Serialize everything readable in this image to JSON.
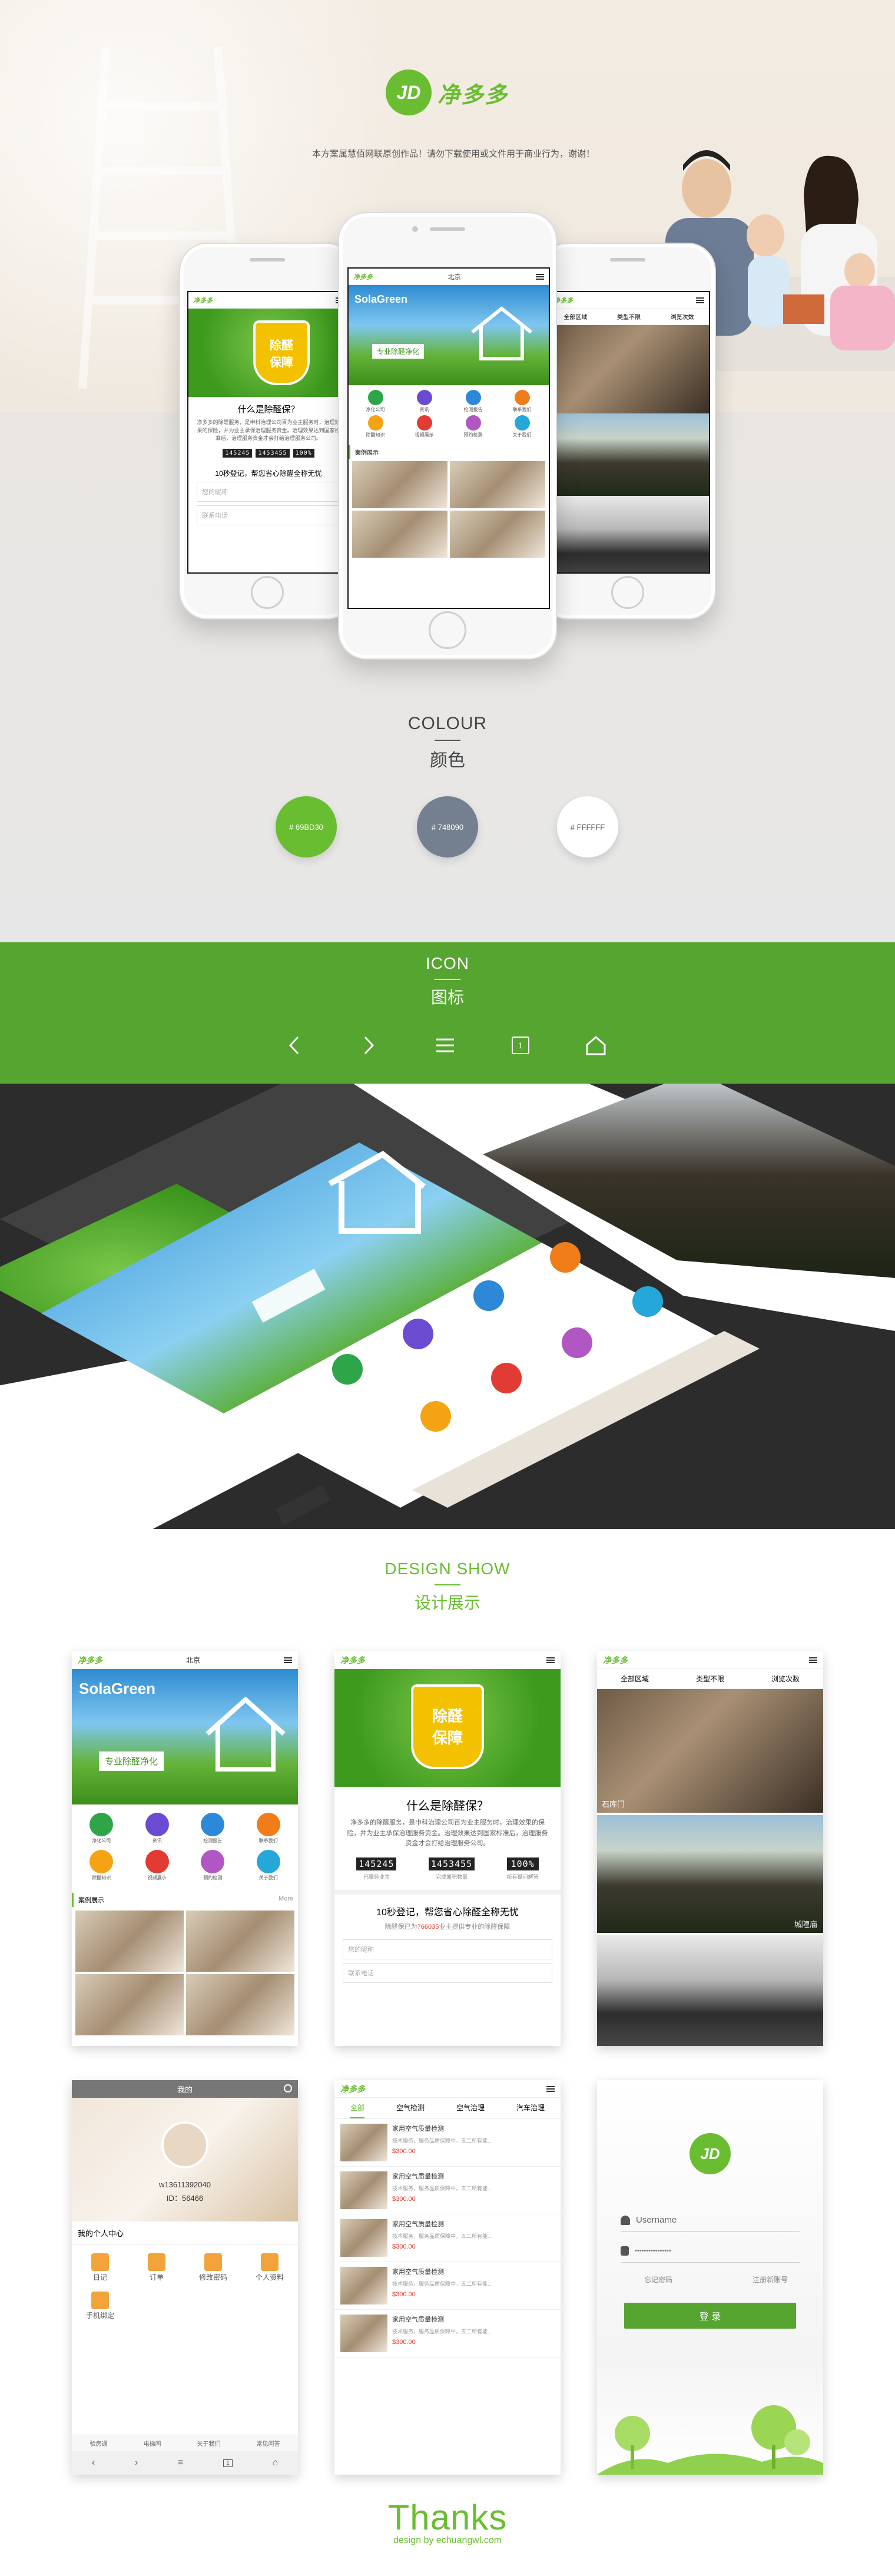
{
  "brand": {
    "name": "净多多",
    "logo_mark": "JD"
  },
  "intro": "本方案属慧佰网联原创作品！请勿下载使用或文件用于商业行为，谢谢！",
  "colour": {
    "title_en": "COLOUR",
    "title_cn": "颜色",
    "swatches": [
      {
        "label": "# 69BD30",
        "color": "#69BD30"
      },
      {
        "label": "# 748090",
        "color": "#748090"
      },
      {
        "label": "# FFFFFF",
        "color": "#FFFFFF"
      }
    ]
  },
  "icon_section": {
    "title_en": "ICON",
    "title_cn": "图标",
    "page_num": "1"
  },
  "design_show": {
    "title_en": "DESIGN SHOW",
    "title_cn": "设计展示"
  },
  "home_screen": {
    "city": "北京",
    "banner_logo": "SolaGreen",
    "banner_text": "专业除醛净化",
    "menu": [
      "净化公司",
      "资讯",
      "检测报告",
      "联系我们",
      "除醛知识",
      "视频展示",
      "预约检测",
      "关于我们"
    ],
    "section_title": "案例展示",
    "more": "More"
  },
  "about_screen": {
    "badge_line1": "除醛",
    "badge_line2": "保障",
    "question": "什么是除醛保？",
    "body": "净多多的除醛服务，是申科治理公司百为业主服务时，治理效果的保险，并为业主承保治理服务资金。治理效果达到国家标准后，治理服务资金才会打给治理服务公司。",
    "stats": [
      {
        "value": "145245",
        "label": "已服务业主"
      },
      {
        "value": "1453455",
        "label": "完成面积数量"
      },
      {
        "value": "100%",
        "label": "所有疑问解答"
      }
    ],
    "promo": "10秒登记，帮您省心除醛全称无忧",
    "promo_sub_prefix": "除醛保已为",
    "promo_count": "766035",
    "promo_sub_suffix": "业主提供专业的除醛保障",
    "field_name": "您的昵称",
    "field_phone": "联系电话"
  },
  "cases_screen": {
    "filters": [
      "全部区域",
      "类型不限",
      "浏览次数"
    ],
    "captions": [
      "石库门",
      "城隍庙"
    ]
  },
  "profile_screen": {
    "title": "我的",
    "account": "w13611392040",
    "id_line": "ID：56466",
    "center": "我的个人中心",
    "items": [
      "日记",
      "订单",
      "修改密码",
      "个人资料",
      "手机绑定"
    ],
    "tabs": [
      "验房通",
      "电梯间",
      "关于我们",
      "常见问答"
    ]
  },
  "products_screen": {
    "tabs": [
      "全部",
      "空气检测",
      "空气治理",
      "汽车治理"
    ],
    "item_title": "家用空气质量检测",
    "item_desc": "技术服务，服务品质保障中，五二所有能…",
    "item_price": "$300.00",
    "count": 5
  },
  "login_screen": {
    "username_placeholder": "Username",
    "password_placeholder": "••••••••••••••••",
    "forgot": "忘记密码",
    "register": "注册新账号",
    "login_button": "登 录"
  },
  "thanks": {
    "big": "Thanks",
    "small": "design by echuangwl.com"
  }
}
